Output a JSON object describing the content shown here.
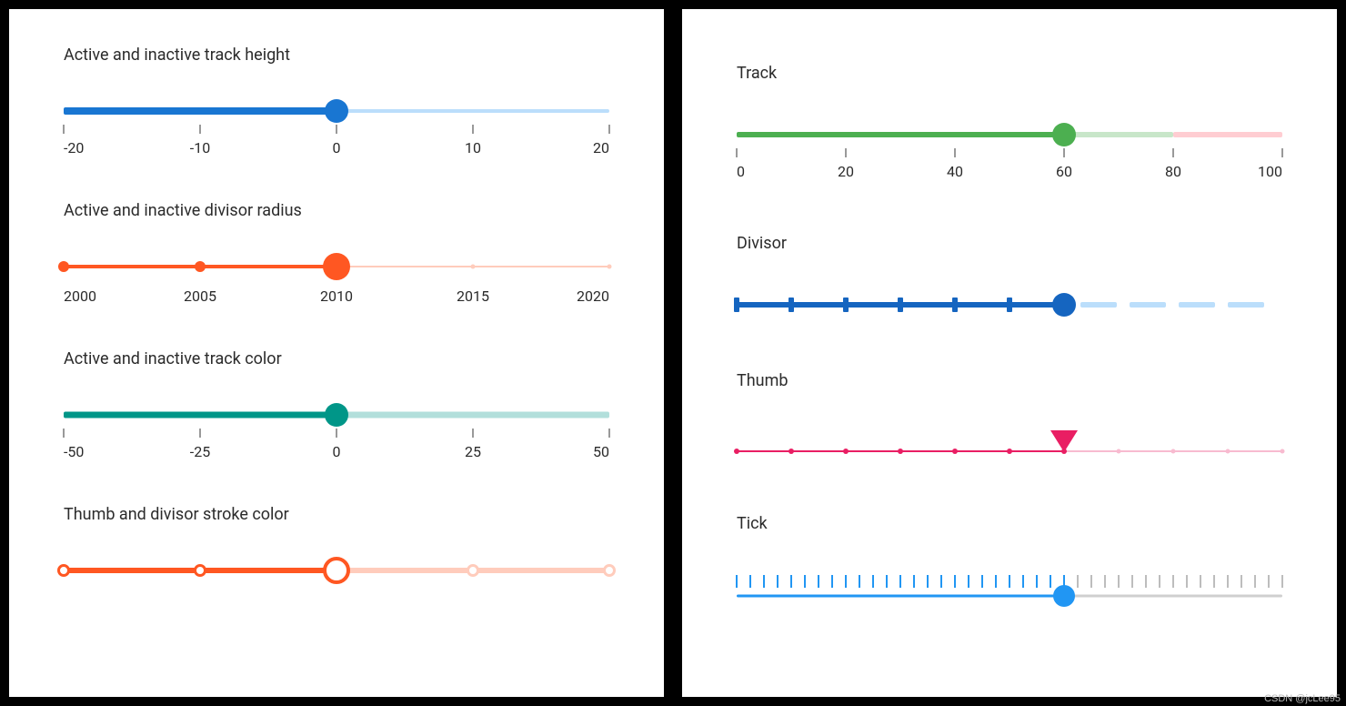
{
  "watermark": "CSDN @jcLee95",
  "left_panel": {
    "sliders": [
      {
        "id": "track-height",
        "title": "Active and inactive track height",
        "min": -20,
        "max": 20,
        "value": 0,
        "step": 10,
        "labels": [
          "-20",
          "-10",
          "0",
          "10",
          "20"
        ],
        "active_color": "#1976d2",
        "inactive_color": "#bbdefb",
        "active_height": 8,
        "inactive_height": 4,
        "thumb_color": "#1976d2",
        "thumb_size": 26
      },
      {
        "id": "divisor-radius",
        "title": "Active and inactive divisor radius",
        "min": 2000,
        "max": 2020,
        "value": 2010,
        "step": 5,
        "labels": [
          "2000",
          "2005",
          "2010",
          "2015",
          "2020"
        ],
        "active_color": "#ff5722",
        "inactive_color": "#ffccbc",
        "active_height": 4,
        "inactive_height": 2,
        "thumb_color": "#ff5722",
        "thumb_size": 30,
        "active_divisor_size": 12,
        "inactive_divisor_size": 5
      },
      {
        "id": "track-color",
        "title": "Active and inactive track color",
        "min": -50,
        "max": 50,
        "value": 0,
        "step": 25,
        "labels": [
          "-50",
          "-25",
          "0",
          "25",
          "50"
        ],
        "active_color": "#009688",
        "inactive_color": "#b2dfdb",
        "active_height": 7,
        "inactive_height": 7,
        "thumb_color": "#009688",
        "thumb_size": 26
      },
      {
        "id": "thumb-stroke",
        "title": "Thumb and divisor stroke color",
        "min": 0,
        "max": 4,
        "value": 2,
        "step": 1,
        "labels": [],
        "active_color": "#ff5722",
        "inactive_color": "#ffccbc",
        "active_height": 6,
        "inactive_height": 6,
        "thumb_fill": "#ffffff",
        "thumb_stroke": "#ff5722",
        "thumb_size": 30,
        "active_divisor_stroke": "#ff5722",
        "inactive_divisor_stroke": "#ffccbc",
        "divisor_fill": "#ffffff",
        "divisor_size": 14
      }
    ]
  },
  "right_panel": {
    "sliders": [
      {
        "id": "track-demo",
        "title": "Track",
        "min": 0,
        "max": 100,
        "value": 60,
        "step": 20,
        "labels": [
          "0",
          "20",
          "40",
          "60",
          "80",
          "100"
        ],
        "segments": [
          {
            "from": 0,
            "to": 60,
            "color": "#4caf50"
          },
          {
            "from": 60,
            "to": 80,
            "color": "#c8e6c9"
          },
          {
            "from": 80,
            "to": 100,
            "color": "#ffcdd2"
          }
        ],
        "track_height": 6,
        "thumb_color": "#4caf50",
        "thumb_size": 26
      },
      {
        "id": "divisor-demo",
        "title": "Divisor",
        "min": 0,
        "max": 100,
        "value": 60,
        "step": 10,
        "active_color": "#1565c0",
        "inactive_color": "#bbdefb",
        "active_height": 6,
        "inactive_style": "dashed",
        "dash_color": "#bbdefb",
        "thumb_color": "#1565c0",
        "thumb_size": 26,
        "tick_color_active": "#1565c0",
        "tick_positions": [
          0,
          10,
          20,
          30,
          40,
          50,
          60
        ]
      },
      {
        "id": "thumb-demo",
        "title": "Thumb",
        "min": 0,
        "max": 100,
        "value": 60,
        "step": 10,
        "active_color": "#e91e63",
        "inactive_color": "#f8bbd0",
        "track_height": 2,
        "dot_color_active": "#e91e63",
        "dot_color_inactive": "#f8bbd0",
        "dot_positions": [
          0,
          10,
          20,
          30,
          40,
          50,
          60,
          70,
          80,
          90,
          100
        ],
        "thumb_shape": "triangle",
        "thumb_color": "#e91e63"
      },
      {
        "id": "tick-demo",
        "title": "Tick",
        "min": 0,
        "max": 100,
        "value": 60,
        "tick_count": 40,
        "active_color": "#2196f3",
        "inactive_color": "#cfcfcf",
        "track_height": 3,
        "thumb_color": "#2196f3",
        "thumb_size": 24,
        "tick_active_color": "#2196f3",
        "tick_inactive_color": "#bdbdbd"
      }
    ]
  }
}
